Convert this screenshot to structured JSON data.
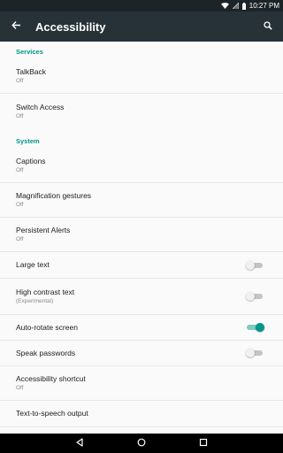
{
  "status_bar": {
    "time": "10:27 PM",
    "icons": [
      "wifi-icon",
      "signal-icon",
      "battery-icon"
    ]
  },
  "app_bar": {
    "title": "Accessibility",
    "back_icon": "arrow-back-icon",
    "search_icon": "search-icon",
    "background": "#263238"
  },
  "sections": {
    "services": {
      "header": "Services",
      "items": [
        {
          "title": "TalkBack",
          "summary": "Off"
        },
        {
          "title": "Switch Access",
          "summary": "Off"
        }
      ]
    },
    "system": {
      "header": "System",
      "items": [
        {
          "title": "Captions",
          "summary": "Off"
        },
        {
          "title": "Magnification gestures",
          "summary": "Off"
        },
        {
          "title": "Persistent Alerts",
          "summary": "Off"
        },
        {
          "title": "Large text",
          "toggle": false
        },
        {
          "title": "High contrast text",
          "summary": "(Experimental)",
          "toggle": false
        },
        {
          "title": "Auto-rotate screen",
          "toggle": true
        },
        {
          "title": "Speak passwords",
          "toggle": false
        },
        {
          "title": "Accessibility shortcut",
          "summary": "Off"
        },
        {
          "title": "Text-to-speech output"
        }
      ]
    }
  },
  "nav_bar": {
    "buttons": [
      "back-triangle-icon",
      "home-circle-icon",
      "recents-square-icon"
    ]
  },
  "colors": {
    "accent": "#009688",
    "status_bar": "#1d2428",
    "nav_bar": "#000000"
  }
}
